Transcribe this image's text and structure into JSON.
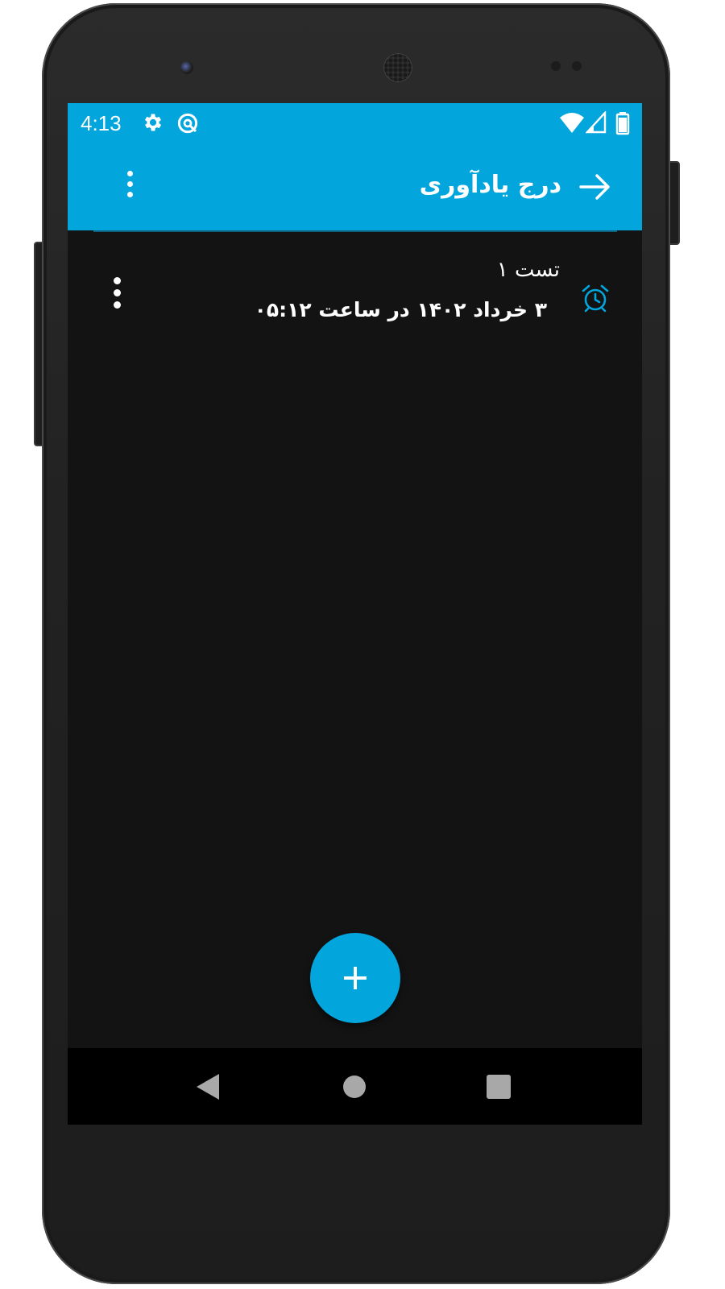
{
  "status_bar": {
    "time": "4:13",
    "icons": [
      "gear-icon",
      "sync-icon",
      "wifi-icon",
      "signal-icon",
      "battery-icon"
    ]
  },
  "app_bar": {
    "title": "درج یادآوری",
    "back_icon": "arrow-right-icon",
    "menu_icon": "more-vert-icon"
  },
  "reminders": [
    {
      "title": "تست ۱",
      "datetime": "۳ خرداد ۱۴۰۲ در ساعت ۰۵:۱۲",
      "icon": "alarm-clock-icon"
    }
  ],
  "fab": {
    "icon": "plus-icon"
  },
  "nav_bar": {
    "icons": [
      "back-triangle-icon",
      "home-circle-icon",
      "recents-square-icon"
    ]
  },
  "colors": {
    "accent": "#03a5dd",
    "background": "#131313",
    "nav": "#000000"
  }
}
